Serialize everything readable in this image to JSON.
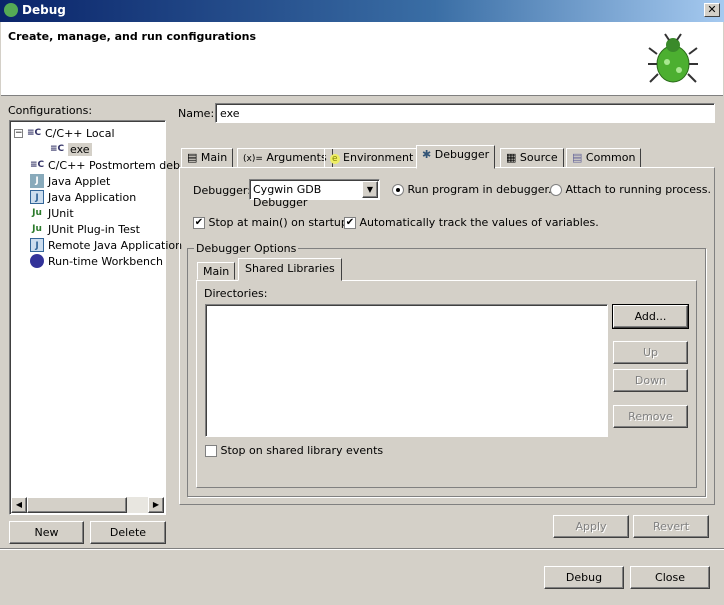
{
  "window": {
    "title": "Debug",
    "close": "✕"
  },
  "header": {
    "title": "Create, manage, and run configurations"
  },
  "configurations": {
    "label": "Configurations:",
    "items": [
      {
        "label": "C/C++ Local",
        "icon": "c-launch-icon"
      },
      {
        "label": "exe",
        "icon": "c-launch-icon"
      },
      {
        "label": "C/C++ Postmortem deb",
        "icon": "c-launch-icon"
      },
      {
        "label": "Java Applet",
        "icon": "java-applet-icon"
      },
      {
        "label": "Java Application",
        "icon": "java-app-icon"
      },
      {
        "label": "JUnit",
        "icon": "junit-icon"
      },
      {
        "label": "JUnit Plug-in Test",
        "icon": "junit-plugin-icon"
      },
      {
        "label": "Remote Java Application",
        "icon": "remote-java-icon"
      },
      {
        "label": "Run-time Workbench",
        "icon": "workbench-icon"
      }
    ],
    "new": "New",
    "delete": "Delete"
  },
  "name": {
    "label": "Name:",
    "value": "exe"
  },
  "tabs": [
    "Main",
    "Arguments",
    "Environment",
    "Debugger",
    "Source",
    "Common"
  ],
  "tab_icons": {
    "main": "▤",
    "arguments": "(x)=",
    "environment": "e",
    "debugger": "✱",
    "source": "▦",
    "common": "▤"
  },
  "debugger": {
    "label": "Debugger:",
    "value": "Cygwin GDB Debugger",
    "run": "Run program in debugger.",
    "attach": "Attach to running process.",
    "stop_main": "Stop at main() on startup.",
    "track": "Automatically track the values of variables.",
    "check": "✔"
  },
  "options": {
    "label": "Debugger Options",
    "tabs": [
      "Main",
      "Shared Libraries"
    ],
    "directories": "Directories:",
    "add": "Add...",
    "up": "Up",
    "down": "Down",
    "remove": "Remove",
    "stop_shared": "Stop on shared library events"
  },
  "footer": {
    "apply": "Apply",
    "revert": "Revert",
    "debug": "Debug",
    "close": "Close"
  }
}
